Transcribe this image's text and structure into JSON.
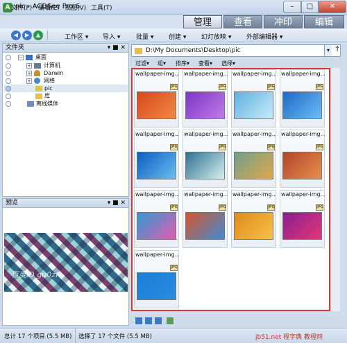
{
  "window": {
    "title": "pic - ACDSee Pro 6",
    "app_icon": "A",
    "min": "–",
    "max": "□",
    "close": "✕"
  },
  "menu": [
    "文件(F)",
    "编辑(E)",
    "视图(V)",
    "工具(T)"
  ],
  "modes": [
    "管理",
    "查看",
    "冲印",
    "编辑"
  ],
  "toolbar": {
    "nav": [
      "◀",
      "▶",
      "▲"
    ],
    "items": [
      "工作区",
      "导入",
      "批量",
      "创建",
      "幻灯放映",
      "外部编辑器"
    ],
    "more": "▾"
  },
  "folder_panel": {
    "title": "文件夹",
    "controls": "▾ ■ ✕"
  },
  "tree": [
    {
      "label": "桌面",
      "expander": "−",
      "icon_color": "#3a6fc7"
    },
    {
      "label": "计算机",
      "expander": "+",
      "icon_color": "#6b7c92"
    },
    {
      "label": "Darwin",
      "expander": "+",
      "icon_color": "#c68f2e"
    },
    {
      "label": "网络",
      "expander": "+",
      "icon_color": "#4a86c9"
    },
    {
      "label": "pic",
      "expander": "",
      "icon_color": "#e6c04d"
    },
    {
      "label": "库",
      "expander": "",
      "icon_color": "#e6c04d"
    },
    {
      "label": "离线媒体",
      "expander": "",
      "icon_color": "#6b8fb8"
    }
  ],
  "preview_panel": {
    "title": "预览",
    "controls": "▾ ■ ✕",
    "watermark": "百度ID gu0zf"
  },
  "path": {
    "value": "D:\\My Documents\\Desktop\\pic",
    "dropdown": "▾",
    "up": "↑"
  },
  "filter_bar": [
    "过滤",
    "组",
    "排序",
    "查看",
    "选择"
  ],
  "files": {
    "name": "wallpaper-img...",
    "badge": "JPG",
    "thumb_colors": [
      [
        "#d7471c",
        "#f08a44"
      ],
      [
        "#7a36c4",
        "#c17be6"
      ],
      [
        "#61b1e3",
        "#c7ebf7"
      ],
      [
        "#1d67c8",
        "#6cc0f2"
      ],
      [
        "#0e5cbf",
        "#68bff0"
      ],
      [
        "#2e6f94",
        "#d6f1ee"
      ],
      [
        "#6fa08c",
        "#e0a84b"
      ],
      [
        "#b0452b",
        "#e88e4e"
      ],
      [
        "#2f9bd3",
        "#e35bb0"
      ],
      [
        "#d7532c",
        "#3f8cd1"
      ],
      [
        "#e08a1c",
        "#f5c14a"
      ],
      [
        "#8a1f8f",
        "#e3357a"
      ],
      [
        "#1a7fd6",
        "#2b8be0"
      ]
    ]
  },
  "bottom_icons": [
    "view-icon-1",
    "view-icon-2",
    "view-icon-3",
    "view-icon-4"
  ],
  "status": {
    "total": "总计 17 个项目 (5.5 MB)",
    "selected": "选择了 17 个文件 (5.5 MB)",
    "watermark": "jb51.net 程字典 教程网"
  }
}
